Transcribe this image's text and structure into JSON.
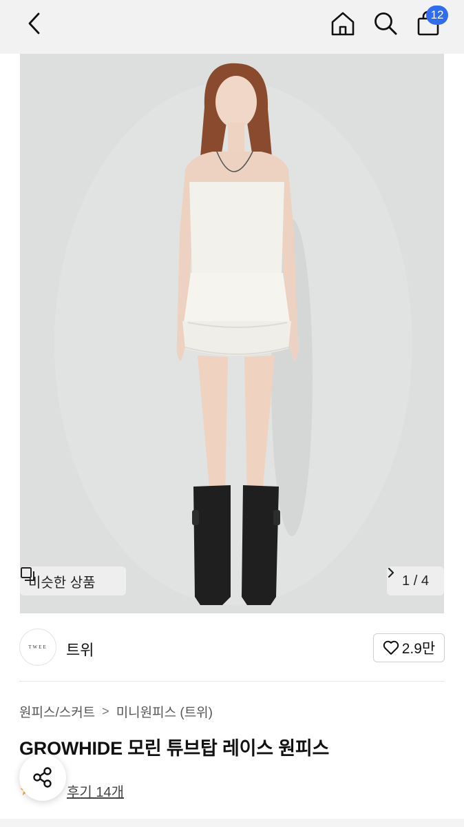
{
  "header": {
    "back_icon": "chevron-left-icon",
    "home_icon": "home-icon",
    "search_icon": "search-icon",
    "cart_icon": "shopping-bag-icon",
    "cart_count": "12",
    "badge_color": "#2f6cf2"
  },
  "hero": {
    "similar_label": "비슷한 상품",
    "similar_icon": "similar-items-icon",
    "image_counter": "1 / 4",
    "next_icon": "chevron-right-icon"
  },
  "brand": {
    "logo_text": "TWEE",
    "name": "트위",
    "like_count": "2.9만",
    "like_icon": "heart-icon"
  },
  "breadcrumb": {
    "level1": "원피스/스커트",
    "level2": "미니원피스 (트위)",
    "separator": ">"
  },
  "product": {
    "title": "GROWHIDE 모린 튜브탑 레이스 원피스",
    "review_label": "후기 14개",
    "star_icon": "star-icon",
    "accent_color": "#f5a623"
  },
  "share": {
    "icon": "share-icon"
  }
}
